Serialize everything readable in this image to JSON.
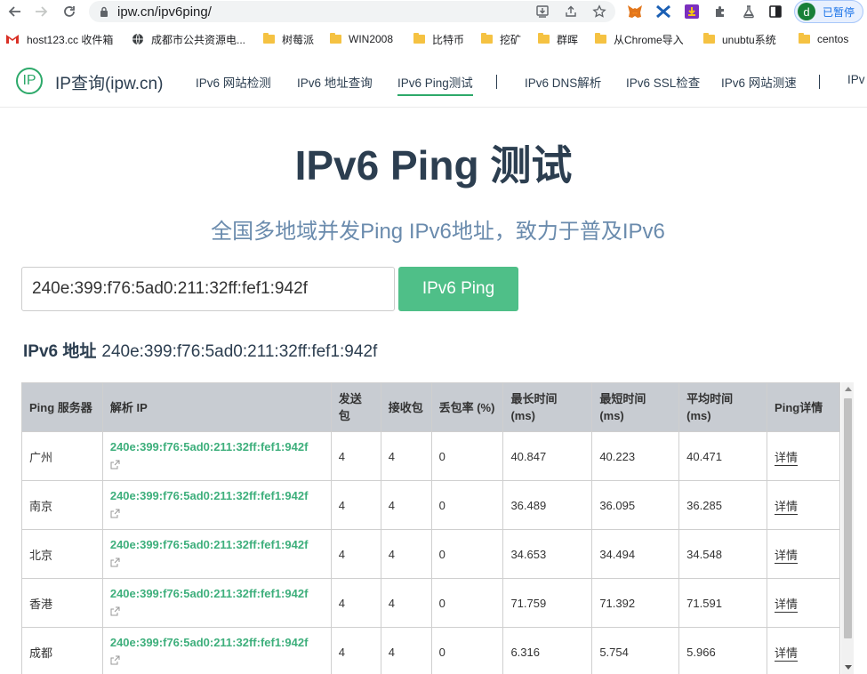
{
  "browser": {
    "url": "ipw.cn/ipv6ping/",
    "profile_initial": "d",
    "profile_status": "已暂停"
  },
  "bookmarks": [
    {
      "label": "host123.cc 收件箱",
      "icon": "gmail-icon"
    },
    {
      "label": "成都市公共资源电...",
      "icon": "globe-icon"
    },
    {
      "label": "树莓派",
      "icon": "folder-icon"
    },
    {
      "label": "WIN2008",
      "icon": "folder-icon"
    },
    {
      "label": "比特币",
      "icon": "folder-icon"
    },
    {
      "label": "挖矿",
      "icon": "folder-icon"
    },
    {
      "label": "群晖",
      "icon": "folder-icon"
    },
    {
      "label": "从Chrome导入",
      "icon": "folder-icon"
    },
    {
      "label": "unubtu系统",
      "icon": "folder-icon"
    },
    {
      "label": "centos",
      "icon": "folder-icon"
    }
  ],
  "site": {
    "logo_text": "IP",
    "brand": "IP查询(ipw.cn)",
    "nav": [
      {
        "label": "IPv6 网站检测"
      },
      {
        "label": "IPv6 地址查询"
      },
      {
        "label": "IPv6 Ping测试"
      },
      {
        "label": "IPv6 DNS解析"
      },
      {
        "label": "IPv6 SSL检查"
      },
      {
        "label": "IPv6 网站测速"
      },
      {
        "label": "IPv"
      }
    ],
    "active_color": "#2da96a"
  },
  "hero": {
    "title": "IPv6 Ping 测试",
    "subtitle": "全国多地域并发Ping IPv6地址，致力于普及IPv6"
  },
  "form": {
    "input_value": "240e:399:f76:5ad0:211:32ff:fef1:942f",
    "button_label": "IPv6 Ping",
    "button_color": "#4fbf88"
  },
  "result": {
    "addr_label": "IPv6 地址",
    "addr_value": "240e:399:f76:5ad0:211:32ff:fef1:942f",
    "headers": [
      "Ping 服务器",
      "解析 IP",
      "发送包",
      "接收包",
      "丢包率 (%)",
      "最长时间 (ms)",
      "最短时间 (ms)",
      "平均时间 (ms)",
      "Ping详情"
    ],
    "rows": [
      {
        "server": "广州",
        "ip": "240e:399:f76:5ad0:211:32ff:fef1:942f",
        "sent": "4",
        "recv": "4",
        "loss": "0",
        "max": "40.847",
        "min": "40.223",
        "avg": "40.471",
        "detail": "详情"
      },
      {
        "server": "南京",
        "ip": "240e:399:f76:5ad0:211:32ff:fef1:942f",
        "sent": "4",
        "recv": "4",
        "loss": "0",
        "max": "36.489",
        "min": "36.095",
        "avg": "36.285",
        "detail": "详情"
      },
      {
        "server": "北京",
        "ip": "240e:399:f76:5ad0:211:32ff:fef1:942f",
        "sent": "4",
        "recv": "4",
        "loss": "0",
        "max": "34.653",
        "min": "34.494",
        "avg": "34.548",
        "detail": "详情"
      },
      {
        "server": "香港",
        "ip": "240e:399:f76:5ad0:211:32ff:fef1:942f",
        "sent": "4",
        "recv": "4",
        "loss": "0",
        "max": "71.759",
        "min": "71.392",
        "avg": "71.591",
        "detail": "详情"
      },
      {
        "server": "成都",
        "ip": "240e:399:f76:5ad0:211:32ff:fef1:942f",
        "sent": "4",
        "recv": "4",
        "loss": "0",
        "max": "6.316",
        "min": "5.754",
        "avg": "5.966",
        "detail": "详情"
      }
    ]
  }
}
